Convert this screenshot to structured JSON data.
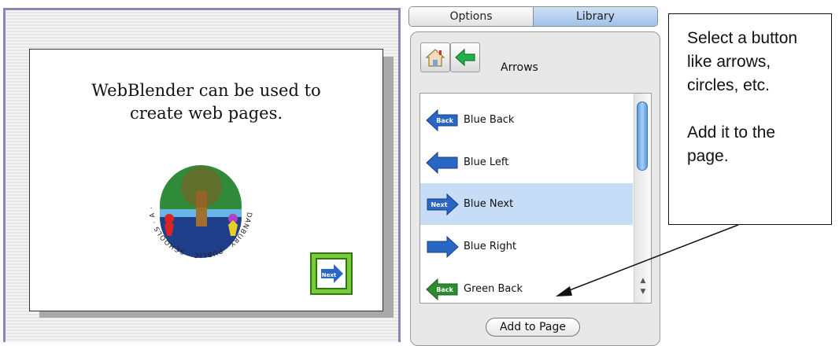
{
  "page": {
    "text_line1": "WebBlender can be used to",
    "text_line2": "create web pages.",
    "logo_text": "DANBURY · PUBLIC · SCHOOLS · A · COMMUNITY · OF · LEARNERS",
    "next_button_art_label": "Next"
  },
  "tabs": [
    {
      "label": "Options",
      "active": false
    },
    {
      "label": "Library",
      "active": true
    }
  ],
  "library": {
    "category": "Arrows",
    "items": [
      {
        "label": "Blue Back",
        "badge": "Back",
        "color": "#2a66c4",
        "direction": "left"
      },
      {
        "label": "Blue Left",
        "badge": "",
        "color": "#2a66c4",
        "direction": "left"
      },
      {
        "label": "Blue Next",
        "badge": "Next",
        "color": "#2a66c4",
        "direction": "right",
        "selected": true
      },
      {
        "label": "Blue Right",
        "badge": "",
        "color": "#2a66c4",
        "direction": "right"
      },
      {
        "label": "Green Back",
        "badge": "Back",
        "color": "#2e8b2e",
        "direction": "left"
      }
    ],
    "add_button": "Add to Page"
  },
  "callout": {
    "line1": "Select a button",
    "line2": "like arrows,",
    "line3": "circles, etc.",
    "line4": "Add it to the",
    "line5": "page."
  },
  "colors": {
    "tab_active": "#9ec2ea",
    "selection": "#c7dcf6",
    "pane_border": "#8a87b5"
  }
}
